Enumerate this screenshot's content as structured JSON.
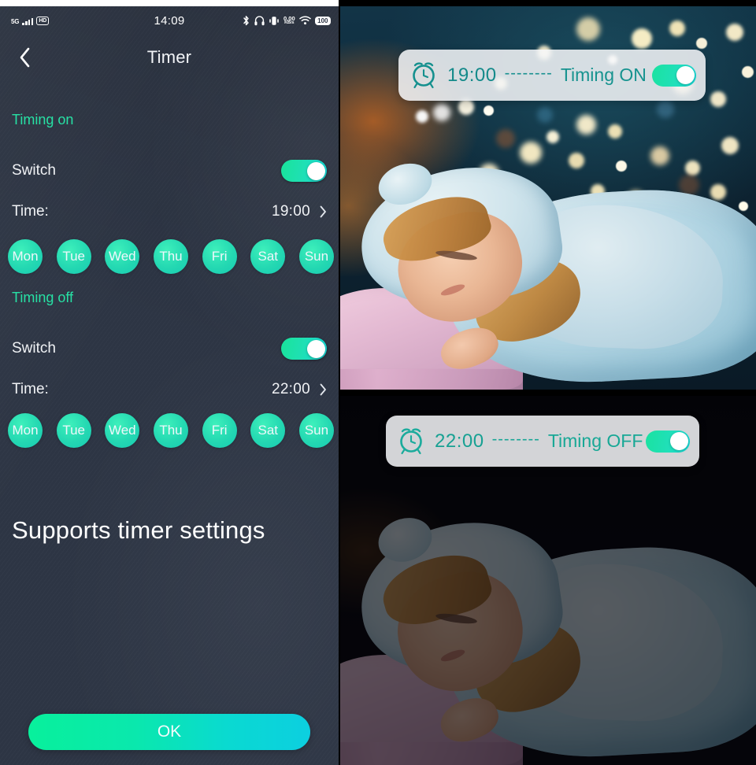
{
  "statusbar": {
    "network_type": "5G",
    "hd_badge": "HD",
    "clock": "14:09",
    "net_speed_value": "0.00",
    "net_speed_unit": "KB/s",
    "battery": "100",
    "icons": [
      "signal-icon",
      "hd-icon",
      "bluetooth-icon",
      "headphones-icon",
      "vibrate-icon",
      "wifi-icon",
      "battery-icon"
    ]
  },
  "header": {
    "back_label": "back-chevron",
    "title": "Timer"
  },
  "timing_on": {
    "section_label": "Timing on",
    "switch_label": "Switch",
    "switch_state": "on",
    "time_label": "Time:",
    "time_value": "19:00",
    "days": [
      "Mon",
      "Tue",
      "Wed",
      "Thu",
      "Fri",
      "Sat",
      "Sun"
    ]
  },
  "timing_off": {
    "section_label": "Timing off",
    "switch_label": "Switch",
    "switch_state": "on",
    "time_label": "Time:",
    "time_value": "22:00",
    "days": [
      "Mon",
      "Tue",
      "Wed",
      "Thu",
      "Fri",
      "Sat",
      "Sun"
    ]
  },
  "headline": "Supports timer settings",
  "ok_button": "OK",
  "overlays": {
    "on_badge": {
      "icon": "alarm-clock-icon",
      "time": "19:00",
      "dash": "--------",
      "label": "Timing ON",
      "toggle_state": "on"
    },
    "off_badge": {
      "icon": "alarm-clock-icon",
      "time": "22:00",
      "dash": "--------",
      "label": "Timing OFF",
      "toggle_state": "on"
    }
  },
  "colors": {
    "panel_bg": "#2d3544",
    "accent_green": "#27e0a4",
    "accent_cyan": "#16d8d8",
    "badge_teal": "#16938f",
    "text_primary": "#f0f2f5"
  }
}
